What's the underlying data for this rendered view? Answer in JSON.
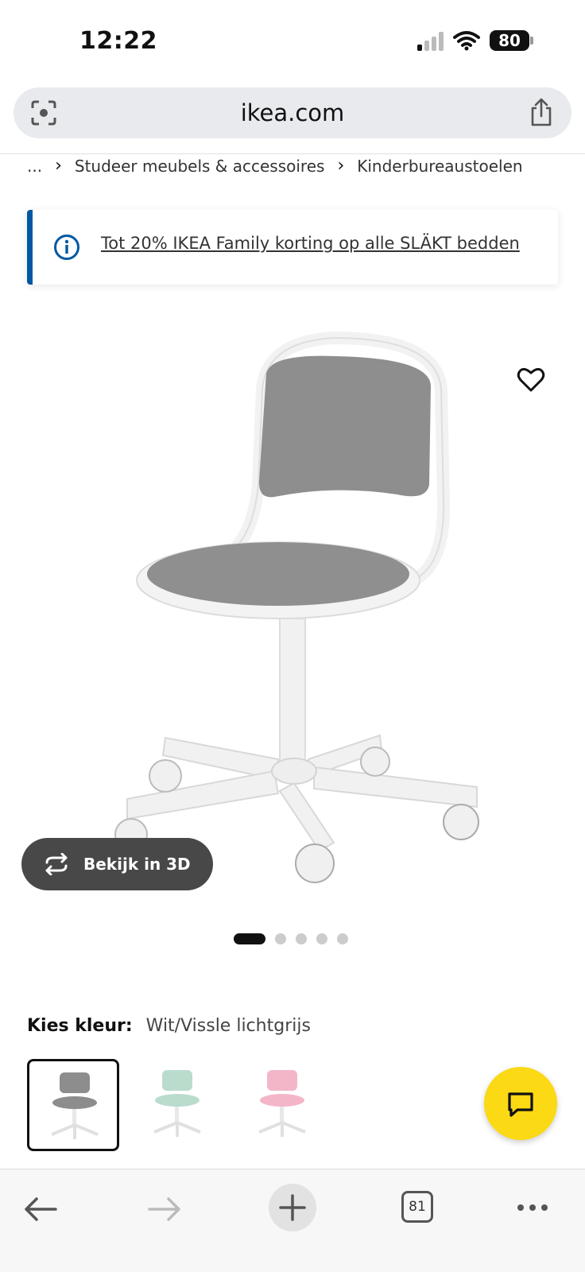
{
  "status_bar": {
    "time": "12:22",
    "battery": "80"
  },
  "browser": {
    "url": "ikea.com",
    "tab_count": "81"
  },
  "breadcrumb": {
    "items": [
      "...",
      "Studeer meubels & accessoires",
      "Kinderbureaustoelen"
    ],
    "separator": "›"
  },
  "banner": {
    "text": "Tot 20% IKEA Family korting op alle SLÄKT bedden",
    "accent_color": "#0058a3"
  },
  "product": {
    "view_3d_label": "Bekijk in 3D",
    "image_count": 5,
    "active_image": 1
  },
  "color_selection": {
    "label": "Kies kleur:",
    "value": "Wit/Vissle lichtgrijs",
    "swatches": [
      {
        "name": "grey",
        "color": "#8d8d8d",
        "selected": true
      },
      {
        "name": "green",
        "color": "#b9dccd",
        "selected": false
      },
      {
        "name": "pink",
        "color": "#f3b6c8",
        "selected": false
      }
    ]
  },
  "chat": {
    "color": "#fbd914"
  },
  "icons": [
    "lens-icon",
    "share-icon",
    "info-icon",
    "heart-icon",
    "rotate-3d-icon",
    "chat-icon",
    "back-arrow-icon",
    "forward-arrow-icon",
    "plus-icon",
    "more-icon"
  ]
}
